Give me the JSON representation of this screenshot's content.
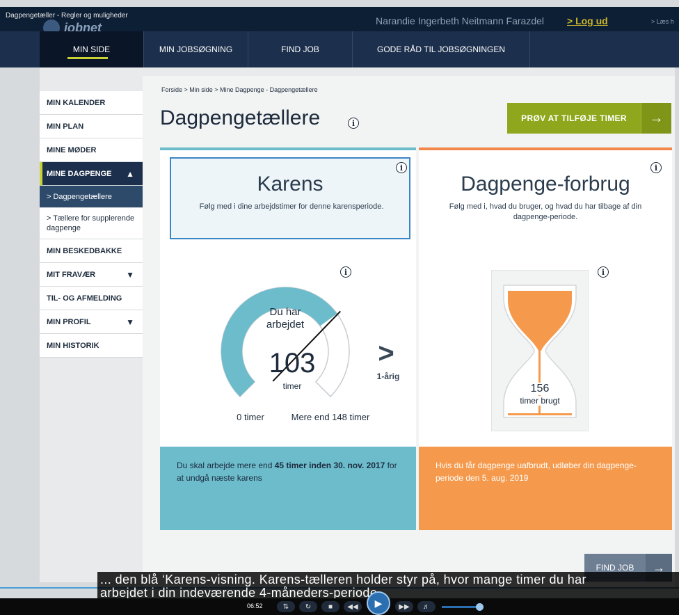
{
  "video": {
    "title": "Dagpengetæller - Regler og muligheder",
    "time": "06:52",
    "progress_fraction": 0.75,
    "subtitle_line1": "... den blå ‘Karens-visning. Karens-tælleren holder styr på, hvor mange timer du har",
    "subtitle_line2": "arbejdet i din indeværende 4-måneders-periode."
  },
  "header": {
    "logo_text": "jobnet",
    "username": "Narandie Ingerbeth Neitmann Farazdel",
    "logout_label": "> Log ud",
    "lasmere": "> Læs h"
  },
  "nav": {
    "items": [
      {
        "label": "MIN SIDE"
      },
      {
        "label": "MIN JOBSØGNING"
      },
      {
        "label": "FIND JOB"
      },
      {
        "label": "GODE RÅD TIL JOBSØGNINGEN"
      }
    ]
  },
  "sidebar": {
    "items": [
      {
        "label": "MIN KALENDER"
      },
      {
        "label": "MIN PLAN"
      },
      {
        "label": "MINE MØDER"
      },
      {
        "label": "MINE DAGPENGE"
      },
      {
        "label": "> Dagpengetællere"
      },
      {
        "label": "> Tællere for supplerende dagpenge"
      },
      {
        "label": "MIN BESKEDBAKKE"
      },
      {
        "label": "MIT FRAVÆR"
      },
      {
        "label": "TIL- OG AFMELDING"
      },
      {
        "label": "MIN PROFIL"
      },
      {
        "label": "MIN HISTORIK"
      }
    ]
  },
  "main": {
    "breadcrumb": "Forside > Min side > Mine Dagpenge - Dagpengetællere",
    "title": "Dagpengetællere",
    "try_button": "PRØV AT TILFØJE TIMER",
    "findjob_button": "FIND JOB"
  },
  "karens": {
    "title": "Karens",
    "subtitle": "Følg med i dine arbejdstimer for denne karensperiode.",
    "gauge_heading_1": "Du har",
    "gauge_heading_2": "arbejdet",
    "hours_value": "103",
    "hours_unit": "timer",
    "min_label": "0 timer",
    "max_label": "Mere end 148 timer",
    "next_label": "1-årig",
    "gauge_fraction": 0.7,
    "footer_pre": "Du skal arbejde mere end ",
    "footer_bold": "45 timer inden 30. nov. 2017",
    "footer_post": " for at undgå næste karens"
  },
  "forbrug": {
    "title": "Dagpenge-forbrug",
    "subtitle": "Følg med i, hvad du bruger, og hvad du har tilbage af din dagpenge-periode.",
    "hours_used": "156",
    "hours_used_label": "timer brugt",
    "footer": "Hvis du får dagpenge uafbrudt, udløber din dagpenge-periode den 5. aug. 2019"
  },
  "colors": {
    "nav_bg": "#1c2f4c",
    "accent_green": "#8fa71c",
    "karens_blue": "#6cbccc",
    "forbrug_orange": "#f59a4c"
  }
}
